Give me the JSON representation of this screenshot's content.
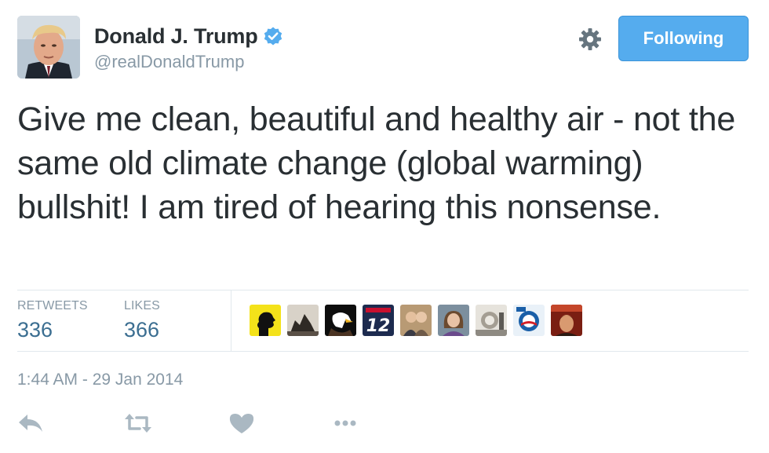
{
  "tweet": {
    "author": {
      "display_name": "Donald J. Trump",
      "handle": "@realDonaldTrump",
      "verified": true
    },
    "follow_button": {
      "label": "Following"
    },
    "text": "Give me clean, beautiful and healthy air - not the same old climate change (global warming) bullshit! I am tired of hearing this nonsense.",
    "stats": {
      "retweets_label": "RETWEETS",
      "retweets_count": "336",
      "likes_label": "LIKES",
      "likes_count": "366"
    },
    "liker_avatar_count": 9,
    "timestamp": "1:44 AM - 29 Jan 2014"
  },
  "icons": {
    "verified": "verified-badge-icon",
    "settings": "gear-icon",
    "reply": "reply-icon",
    "retweet": "retweet-icon",
    "like": "heart-icon",
    "more": "more-dots-icon"
  },
  "colors": {
    "accent_blue": "#55acee",
    "stat_value": "#3b6e91",
    "muted_text": "#8899a6",
    "action_icon": "#aab8c2",
    "divider": "#e1e8ed"
  }
}
